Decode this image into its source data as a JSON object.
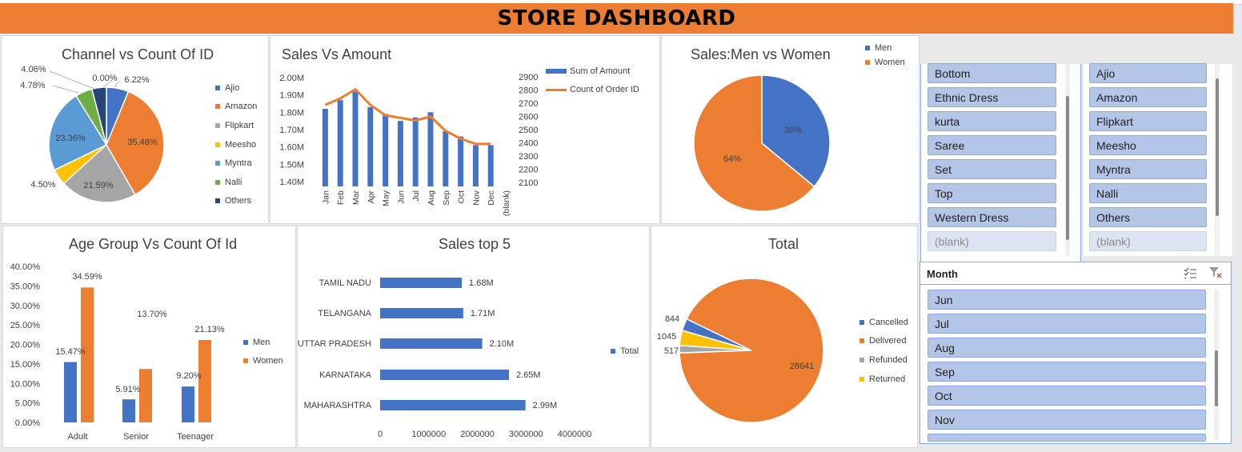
{
  "dashboard": {
    "title": "STORE DASHBOARD"
  },
  "channel_chart": {
    "title": "Channel vs Count Of ID",
    "legend": [
      "Ajio",
      "Amazon",
      "Flipkart",
      "Meesho",
      "Myntra",
      "Nalli",
      "Others"
    ],
    "colors": [
      "#4472c4",
      "#ed7d31",
      "#a5a5a5",
      "#ffc000",
      "#5b9bd5",
      "#70ad47",
      "#264478"
    ],
    "labels": [
      "6.22%",
      "35.48%",
      "21.59%",
      "4.50%",
      "23.36%",
      "4.78%",
      "4.06%",
      "0.00%"
    ]
  },
  "sales_amount_chart": {
    "title": "Sales Vs Amount",
    "legend_bar": "Sum of Amount",
    "legend_line": "Count of Order ID",
    "left_ticks": [
      "2.00M",
      "1.90M",
      "1.80M",
      "1.70M",
      "1.60M",
      "1.50M",
      "1.40M"
    ],
    "right_ticks": [
      "2900",
      "2800",
      "2700",
      "2600",
      "2500",
      "2400",
      "2300",
      "2200",
      "2100"
    ]
  },
  "men_women_chart": {
    "title": "Sales:Men vs Women",
    "legend": [
      "Men",
      "Women"
    ],
    "colors": [
      "#4472c4",
      "#ed7d31"
    ],
    "labels": [
      "36%",
      "64%"
    ]
  },
  "age_chart": {
    "title": "Age Group Vs Count Of Id",
    "y_ticks": [
      "40.00%",
      "35.00%",
      "30.00%",
      "25.00%",
      "20.00%",
      "15.00%",
      "10.00%",
      "5.00%",
      "0.00%"
    ],
    "legend": [
      "Men",
      "Women"
    ],
    "data_labels": [
      "15.47%",
      "34.59%",
      "5.91%",
      "13.70%",
      "9.20%",
      "21.13%"
    ]
  },
  "top5_chart": {
    "title": "Sales top 5",
    "x_ticks": [
      "0",
      "1000000",
      "2000000",
      "3000000",
      "4000000"
    ],
    "legend": "Total",
    "data_labels": [
      "1.68M",
      "1.71M",
      "2.10M",
      "2.65M",
      "2.99M"
    ]
  },
  "status_chart": {
    "title": "Total",
    "legend": [
      "Cancelled",
      "Delivered",
      "Refunded",
      "Returned"
    ],
    "colors": [
      "#4472c4",
      "#ed7d31",
      "#a5a5a5",
      "#ffc000"
    ],
    "labels": [
      "844",
      "1045",
      "517",
      "28641"
    ]
  },
  "chart_data": [
    {
      "type": "pie",
      "title": "Channel vs Count Of ID",
      "categories": [
        "Ajio",
        "Amazon",
        "Flipkart",
        "Meesho",
        "Myntra",
        "Nalli",
        "Others"
      ],
      "values": [
        6.22,
        35.48,
        21.59,
        4.5,
        23.36,
        4.78,
        4.06
      ],
      "legend_position": "right"
    },
    {
      "type": "bar",
      "title": "Sales Vs Amount",
      "categories": [
        "Jan",
        "Feb",
        "Mar",
        "Apr",
        "May",
        "Jun",
        "Jul",
        "Aug",
        "Sep",
        "Oct",
        "Nov",
        "Dec",
        "(blank)"
      ],
      "series": [
        {
          "name": "Sum of Amount",
          "type": "bar",
          "axis": "left",
          "values": [
            1.82,
            1.87,
            1.92,
            1.83,
            1.79,
            1.75,
            1.77,
            1.8,
            1.69,
            1.66,
            1.61,
            1.61,
            null
          ]
        },
        {
          "name": "Count of Order ID",
          "type": "line",
          "axis": "right",
          "values": [
            2690,
            2740,
            2810,
            2690,
            2610,
            2590,
            2570,
            2600,
            2490,
            2430,
            2390,
            2390,
            null
          ]
        }
      ],
      "ylim_left": [
        1.4,
        2.0
      ],
      "ylim_right": [
        2100,
        2900
      ],
      "legend_position": "top-right"
    },
    {
      "type": "pie",
      "title": "Sales:Men vs Women",
      "categories": [
        "Men",
        "Women"
      ],
      "values": [
        36,
        64
      ],
      "legend_position": "top-right"
    },
    {
      "type": "bar",
      "title": "Age Group Vs Count Of Id",
      "categories": [
        "Adult",
        "Senior",
        "Teenager"
      ],
      "series": [
        {
          "name": "Men",
          "values": [
            15.47,
            5.91,
            9.2
          ]
        },
        {
          "name": "Women",
          "values": [
            34.59,
            13.7,
            21.13
          ]
        }
      ],
      "ylim": [
        0,
        40
      ],
      "legend_position": "right"
    },
    {
      "type": "bar",
      "orientation": "horizontal",
      "title": "Sales top 5",
      "categories": [
        "TAMIL NADU",
        "TELANGANA",
        "UTTAR PRADESH",
        "KARNATAKA",
        "MAHARASHTRA"
      ],
      "series": [
        {
          "name": "Total",
          "values": [
            1680000,
            1710000,
            2100000,
            2650000,
            2990000
          ]
        }
      ],
      "xlim": [
        0,
        4000000
      ],
      "legend_position": "right"
    },
    {
      "type": "pie",
      "title": "Total",
      "categories": [
        "Cancelled",
        "Delivered",
        "Refunded",
        "Returned"
      ],
      "values": [
        844,
        28641,
        517,
        1045
      ],
      "legend_position": "right"
    }
  ],
  "slicer_category": {
    "items": [
      "Bottom",
      "Ethnic Dress",
      "kurta",
      "Saree",
      "Set",
      "Top",
      "Western Dress",
      "(blank)"
    ]
  },
  "slicer_channel": {
    "items": [
      "Ajio",
      "Amazon",
      "Flipkart",
      "Meesho",
      "Myntra",
      "Nalli",
      "Others",
      "(blank)"
    ]
  },
  "slicer_month": {
    "header": "Month",
    "items": [
      "Jun",
      "Jul",
      "Aug",
      "Sep",
      "Oct",
      "Nov"
    ],
    "multiselect_icon": "multiselect-icon",
    "clear_filter_icon": "clear-filter-icon"
  }
}
